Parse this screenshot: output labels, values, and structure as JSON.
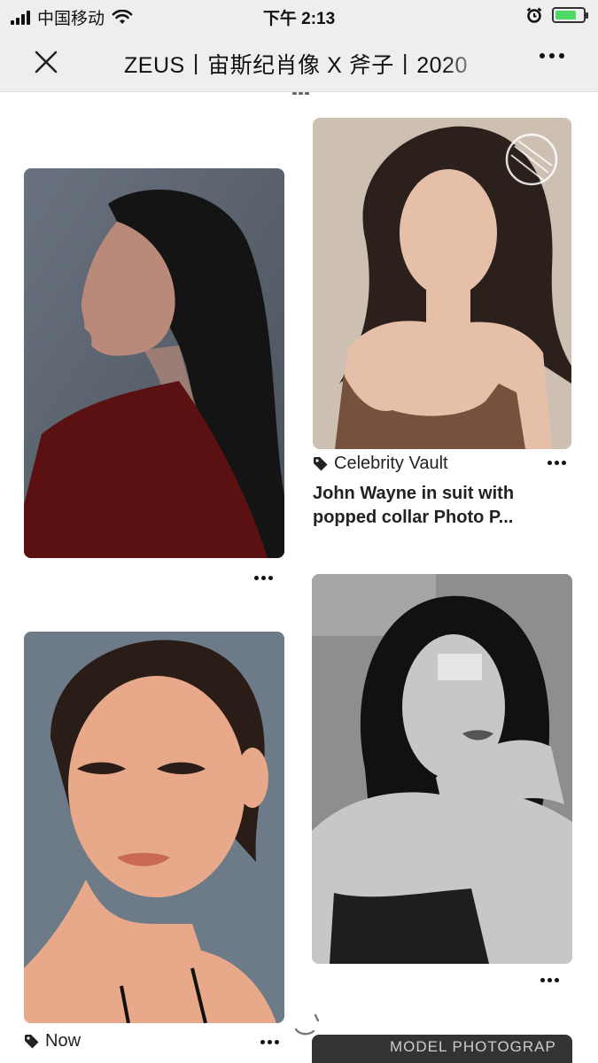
{
  "status_bar": {
    "carrier": "中国移动",
    "time": "下午 2:13",
    "battery_level": 0.75
  },
  "nav": {
    "title": "ZEUS丨宙斯纪肖像 X 斧子丨2020"
  },
  "pins": [
    {
      "image": "portrait-dark-profile",
      "colors": {
        "bg": "#5a6470",
        "hair": "#141414",
        "clothing": "#5b1111",
        "skin": "#b9897a"
      }
    },
    {
      "image": "portrait-beige-brown-top",
      "source": "Celebrity Vault",
      "title_line1": "John Wayne in suit with",
      "title_line2": "popped collar Photo P...",
      "colors": {
        "bg": "#cdbfb2",
        "hair": "#2b201b",
        "top": "#76513d",
        "skin": "#e6bfa8"
      }
    },
    {
      "image": "portrait-closeup-warm",
      "source": "Now",
      "colors": {
        "bg": "#6d7a87",
        "hair": "#2a1c16",
        "skin": "#e8a98a"
      }
    },
    {
      "image": "portrait-black-and-white",
      "colors": {
        "bg": "#8e8e8e",
        "hair": "#111111",
        "skin": "#c7c7c7"
      }
    }
  ],
  "watermark": "MODEL PHOTOGRAP"
}
